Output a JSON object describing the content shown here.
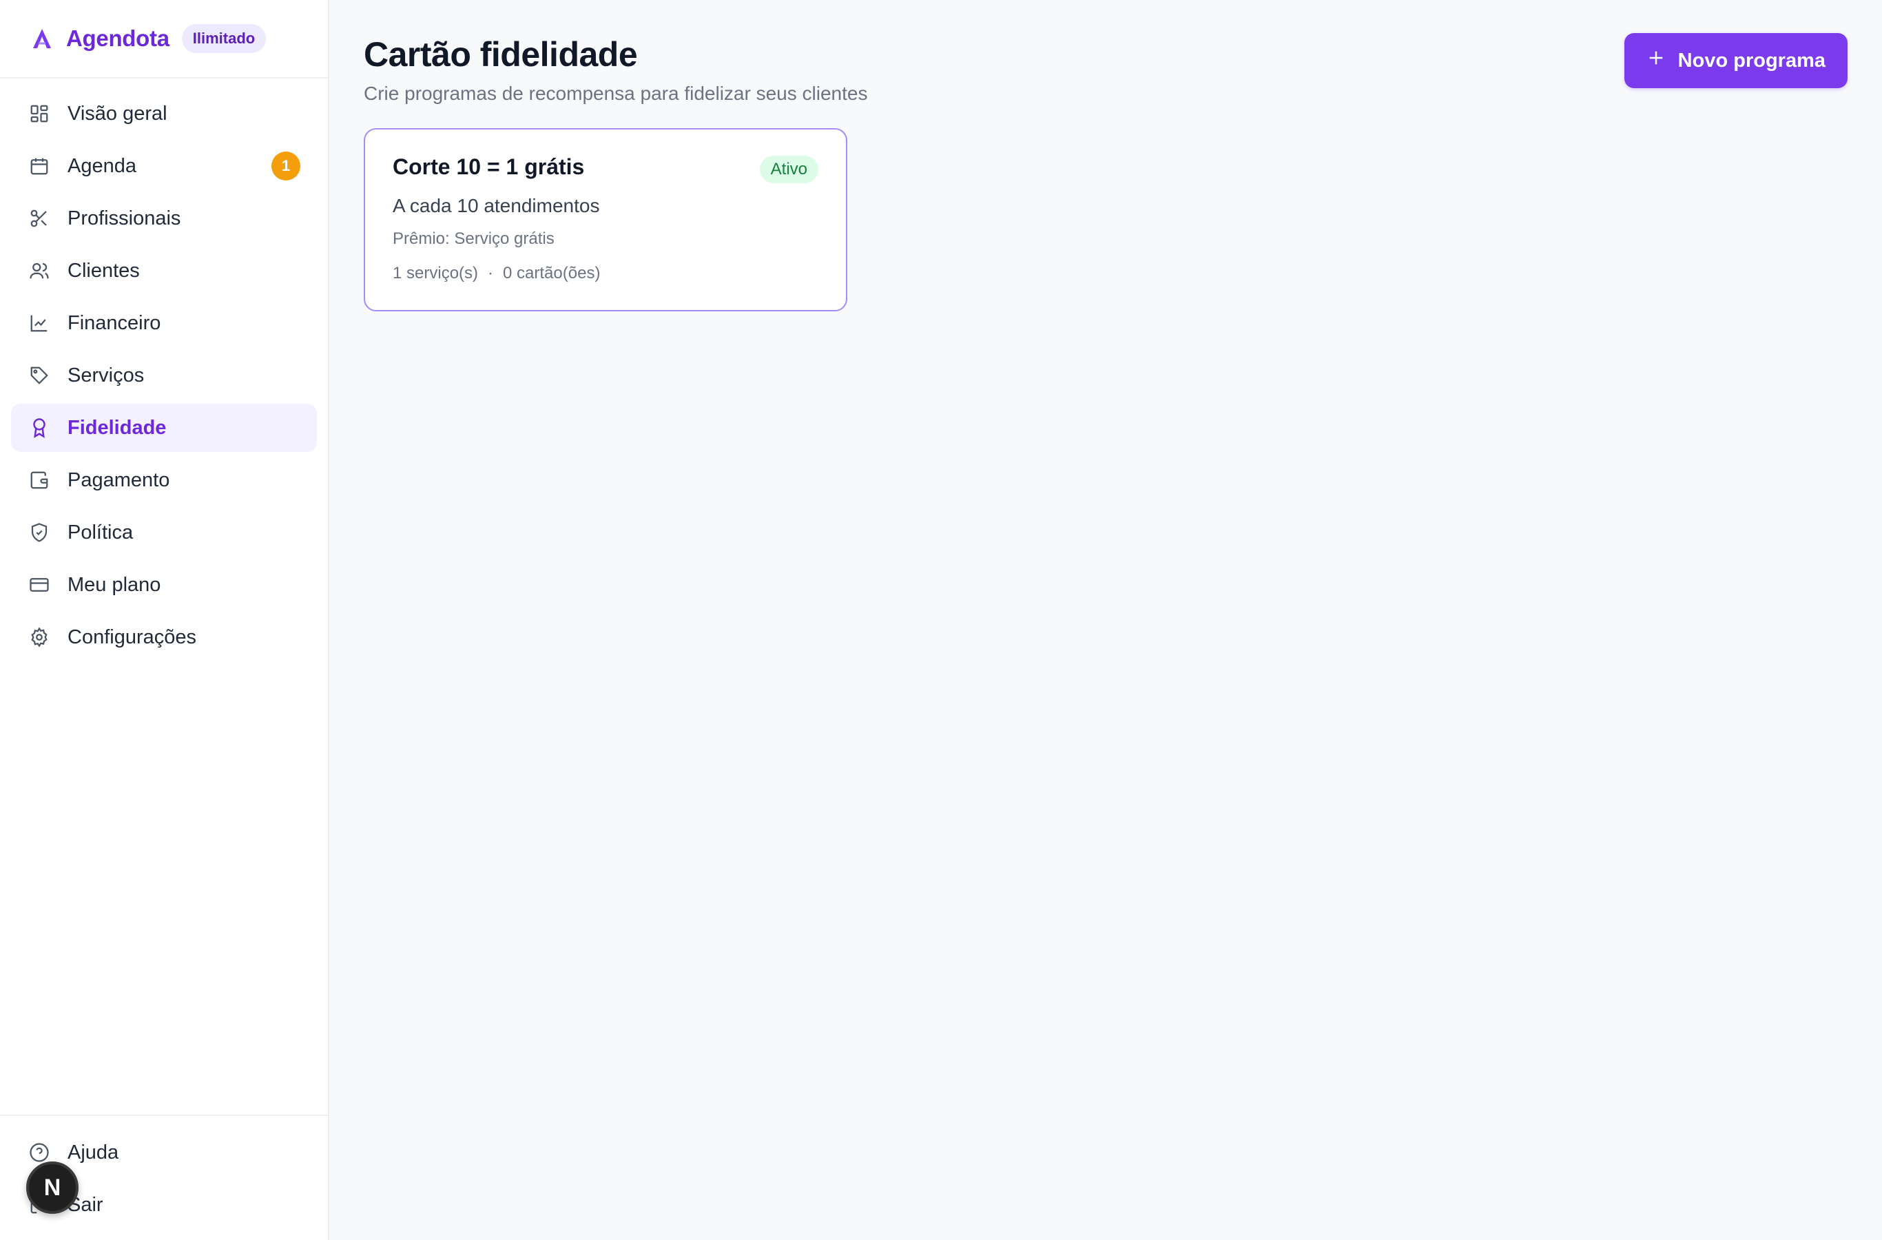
{
  "brand": {
    "name": "Agendota",
    "plan_badge": "Ilimitado"
  },
  "sidebar": {
    "items": [
      {
        "label": "Visão geral",
        "icon": "dashboard-icon"
      },
      {
        "label": "Agenda",
        "icon": "calendar-icon",
        "badge": "1"
      },
      {
        "label": "Profissionais",
        "icon": "scissors-icon"
      },
      {
        "label": "Clientes",
        "icon": "users-icon"
      },
      {
        "label": "Financeiro",
        "icon": "chart-line-icon"
      },
      {
        "label": "Serviços",
        "icon": "tag-icon"
      },
      {
        "label": "Fidelidade",
        "icon": "award-icon",
        "active": true
      },
      {
        "label": "Pagamento",
        "icon": "wallet-icon"
      },
      {
        "label": "Política",
        "icon": "shield-check-icon"
      },
      {
        "label": "Meu plano",
        "icon": "credit-card-icon"
      },
      {
        "label": "Configurações",
        "icon": "gear-icon"
      }
    ],
    "footer": [
      {
        "label": "Ajuda",
        "icon": "help-circle-icon"
      },
      {
        "label": "Sair",
        "icon": "logout-icon"
      }
    ],
    "floating_bubble": "N"
  },
  "header": {
    "title": "Cartão fidelidade",
    "subtitle": "Crie programas de recompensa para fidelizar seus clientes",
    "new_button_label": "Novo programa"
  },
  "programs": [
    {
      "title": "Corte 10 = 1 grátis",
      "status": "Ativo",
      "description": "A cada 10 atendimentos",
      "reward": "Prêmio: Serviço grátis",
      "services": "1 serviço(s)",
      "separator": "·",
      "cards": "0 cartão(ões)"
    }
  ],
  "colors": {
    "accent": "#7c3aed",
    "accent_text": "#6d28d9",
    "active_bg": "#f3f0ff",
    "badge_orange": "#f59e0b",
    "status_green_bg": "#dcfce7",
    "status_green_text": "#15803d"
  }
}
